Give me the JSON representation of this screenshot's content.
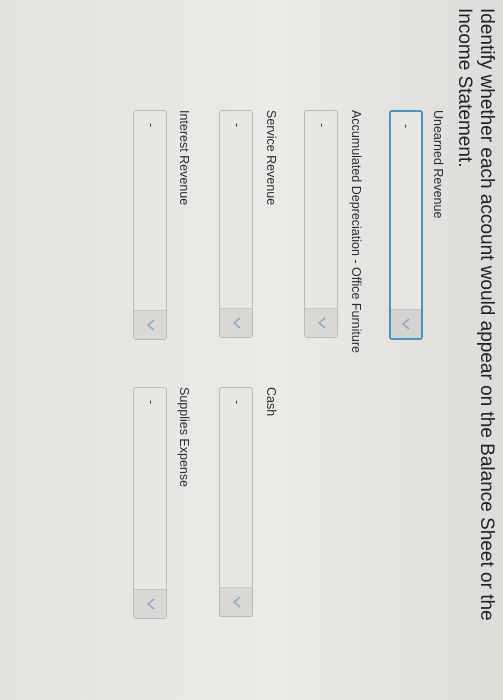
{
  "question": "Identify whether each account would appear on the Balance Sheet or the Income Statement.",
  "accounts": [
    {
      "label": "Unearned Revenue",
      "value": "-"
    },
    {
      "label": "Accumulated Depreciation - Office Furniture",
      "value": "-"
    },
    {
      "label": "Service Revenue",
      "value": "-"
    },
    {
      "label": "Interest Revenue",
      "value": "-"
    },
    {
      "label": "Cash",
      "value": "-"
    },
    {
      "label": "Supplies Expense",
      "value": "-"
    }
  ],
  "colors": {
    "focus_border": "#3d97c8",
    "chevron": "#8aa9c6"
  },
  "icons": {
    "dropdown": "chevron-down-icon",
    "cursor": "mouse-pointer-icon"
  }
}
